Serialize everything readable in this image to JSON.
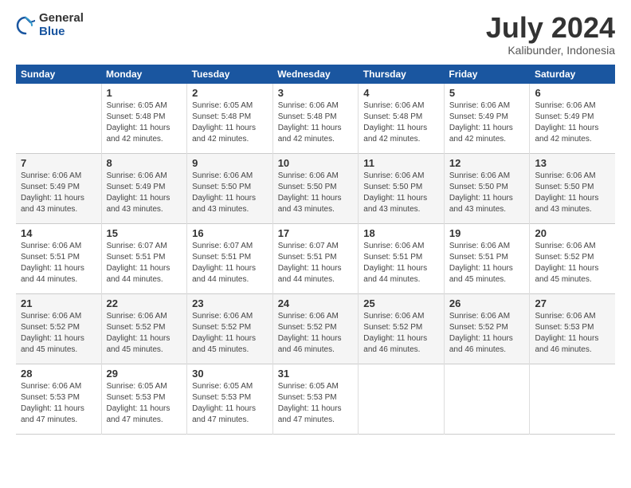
{
  "logo": {
    "general": "General",
    "blue": "Blue"
  },
  "title": "July 2024",
  "location": "Kalibunder, Indonesia",
  "days_of_week": [
    "Sunday",
    "Monday",
    "Tuesday",
    "Wednesday",
    "Thursday",
    "Friday",
    "Saturday"
  ],
  "weeks": [
    [
      {
        "num": "",
        "info": ""
      },
      {
        "num": "1",
        "info": "Sunrise: 6:05 AM\nSunset: 5:48 PM\nDaylight: 11 hours\nand 42 minutes."
      },
      {
        "num": "2",
        "info": "Sunrise: 6:05 AM\nSunset: 5:48 PM\nDaylight: 11 hours\nand 42 minutes."
      },
      {
        "num": "3",
        "info": "Sunrise: 6:06 AM\nSunset: 5:48 PM\nDaylight: 11 hours\nand 42 minutes."
      },
      {
        "num": "4",
        "info": "Sunrise: 6:06 AM\nSunset: 5:48 PM\nDaylight: 11 hours\nand 42 minutes."
      },
      {
        "num": "5",
        "info": "Sunrise: 6:06 AM\nSunset: 5:49 PM\nDaylight: 11 hours\nand 42 minutes."
      },
      {
        "num": "6",
        "info": "Sunrise: 6:06 AM\nSunset: 5:49 PM\nDaylight: 11 hours\nand 42 minutes."
      }
    ],
    [
      {
        "num": "7",
        "info": "Sunrise: 6:06 AM\nSunset: 5:49 PM\nDaylight: 11 hours\nand 43 minutes."
      },
      {
        "num": "8",
        "info": "Sunrise: 6:06 AM\nSunset: 5:49 PM\nDaylight: 11 hours\nand 43 minutes."
      },
      {
        "num": "9",
        "info": "Sunrise: 6:06 AM\nSunset: 5:50 PM\nDaylight: 11 hours\nand 43 minutes."
      },
      {
        "num": "10",
        "info": "Sunrise: 6:06 AM\nSunset: 5:50 PM\nDaylight: 11 hours\nand 43 minutes."
      },
      {
        "num": "11",
        "info": "Sunrise: 6:06 AM\nSunset: 5:50 PM\nDaylight: 11 hours\nand 43 minutes."
      },
      {
        "num": "12",
        "info": "Sunrise: 6:06 AM\nSunset: 5:50 PM\nDaylight: 11 hours\nand 43 minutes."
      },
      {
        "num": "13",
        "info": "Sunrise: 6:06 AM\nSunset: 5:50 PM\nDaylight: 11 hours\nand 43 minutes."
      }
    ],
    [
      {
        "num": "14",
        "info": "Sunrise: 6:06 AM\nSunset: 5:51 PM\nDaylight: 11 hours\nand 44 minutes."
      },
      {
        "num": "15",
        "info": "Sunrise: 6:07 AM\nSunset: 5:51 PM\nDaylight: 11 hours\nand 44 minutes."
      },
      {
        "num": "16",
        "info": "Sunrise: 6:07 AM\nSunset: 5:51 PM\nDaylight: 11 hours\nand 44 minutes."
      },
      {
        "num": "17",
        "info": "Sunrise: 6:07 AM\nSunset: 5:51 PM\nDaylight: 11 hours\nand 44 minutes."
      },
      {
        "num": "18",
        "info": "Sunrise: 6:06 AM\nSunset: 5:51 PM\nDaylight: 11 hours\nand 44 minutes."
      },
      {
        "num": "19",
        "info": "Sunrise: 6:06 AM\nSunset: 5:51 PM\nDaylight: 11 hours\nand 45 minutes."
      },
      {
        "num": "20",
        "info": "Sunrise: 6:06 AM\nSunset: 5:52 PM\nDaylight: 11 hours\nand 45 minutes."
      }
    ],
    [
      {
        "num": "21",
        "info": "Sunrise: 6:06 AM\nSunset: 5:52 PM\nDaylight: 11 hours\nand 45 minutes."
      },
      {
        "num": "22",
        "info": "Sunrise: 6:06 AM\nSunset: 5:52 PM\nDaylight: 11 hours\nand 45 minutes."
      },
      {
        "num": "23",
        "info": "Sunrise: 6:06 AM\nSunset: 5:52 PM\nDaylight: 11 hours\nand 45 minutes."
      },
      {
        "num": "24",
        "info": "Sunrise: 6:06 AM\nSunset: 5:52 PM\nDaylight: 11 hours\nand 46 minutes."
      },
      {
        "num": "25",
        "info": "Sunrise: 6:06 AM\nSunset: 5:52 PM\nDaylight: 11 hours\nand 46 minutes."
      },
      {
        "num": "26",
        "info": "Sunrise: 6:06 AM\nSunset: 5:52 PM\nDaylight: 11 hours\nand 46 minutes."
      },
      {
        "num": "27",
        "info": "Sunrise: 6:06 AM\nSunset: 5:53 PM\nDaylight: 11 hours\nand 46 minutes."
      }
    ],
    [
      {
        "num": "28",
        "info": "Sunrise: 6:06 AM\nSunset: 5:53 PM\nDaylight: 11 hours\nand 47 minutes."
      },
      {
        "num": "29",
        "info": "Sunrise: 6:05 AM\nSunset: 5:53 PM\nDaylight: 11 hours\nand 47 minutes."
      },
      {
        "num": "30",
        "info": "Sunrise: 6:05 AM\nSunset: 5:53 PM\nDaylight: 11 hours\nand 47 minutes."
      },
      {
        "num": "31",
        "info": "Sunrise: 6:05 AM\nSunset: 5:53 PM\nDaylight: 11 hours\nand 47 minutes."
      },
      {
        "num": "",
        "info": ""
      },
      {
        "num": "",
        "info": ""
      },
      {
        "num": "",
        "info": ""
      }
    ]
  ]
}
